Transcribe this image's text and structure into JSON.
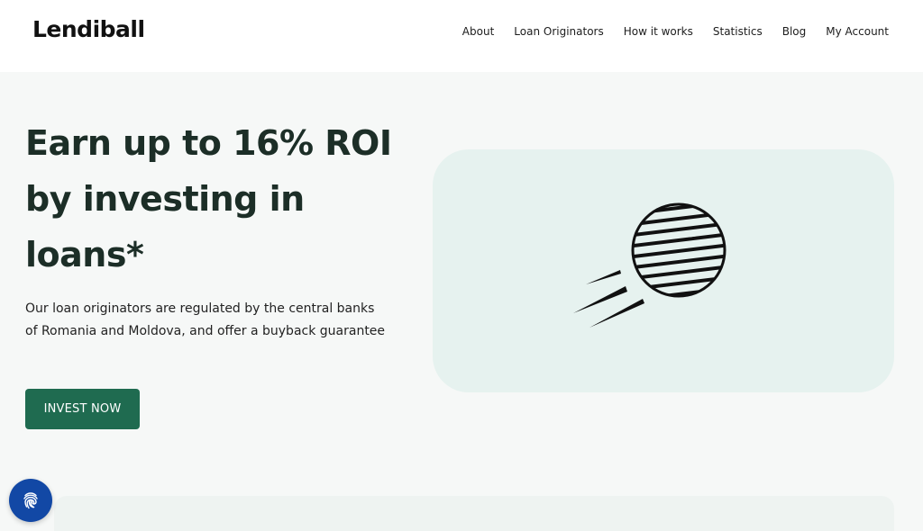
{
  "header": {
    "logo": "Lendiball",
    "nav": [
      {
        "label": "About"
      },
      {
        "label": "Loan Originators"
      },
      {
        "label": "How it works"
      },
      {
        "label": "Statistics"
      },
      {
        "label": "Blog"
      },
      {
        "label": "My Account"
      }
    ]
  },
  "hero": {
    "title": "Earn up to 16% ROI by investing in loans*",
    "subtitle": "Our loan originators are regulated by the central banks of Romania and Moldova, and offer a buyback guarantee",
    "cta_label": "INVEST NOW",
    "illustration_icon": "flying-ball-icon"
  },
  "floating": {
    "icon": "fingerprint-icon"
  },
  "colors": {
    "accent": "#1f6b50",
    "hero_bg": "#f6f8f7",
    "illustration_bg": "#e6f2ef",
    "fingerprint_bg": "#1248a5"
  }
}
